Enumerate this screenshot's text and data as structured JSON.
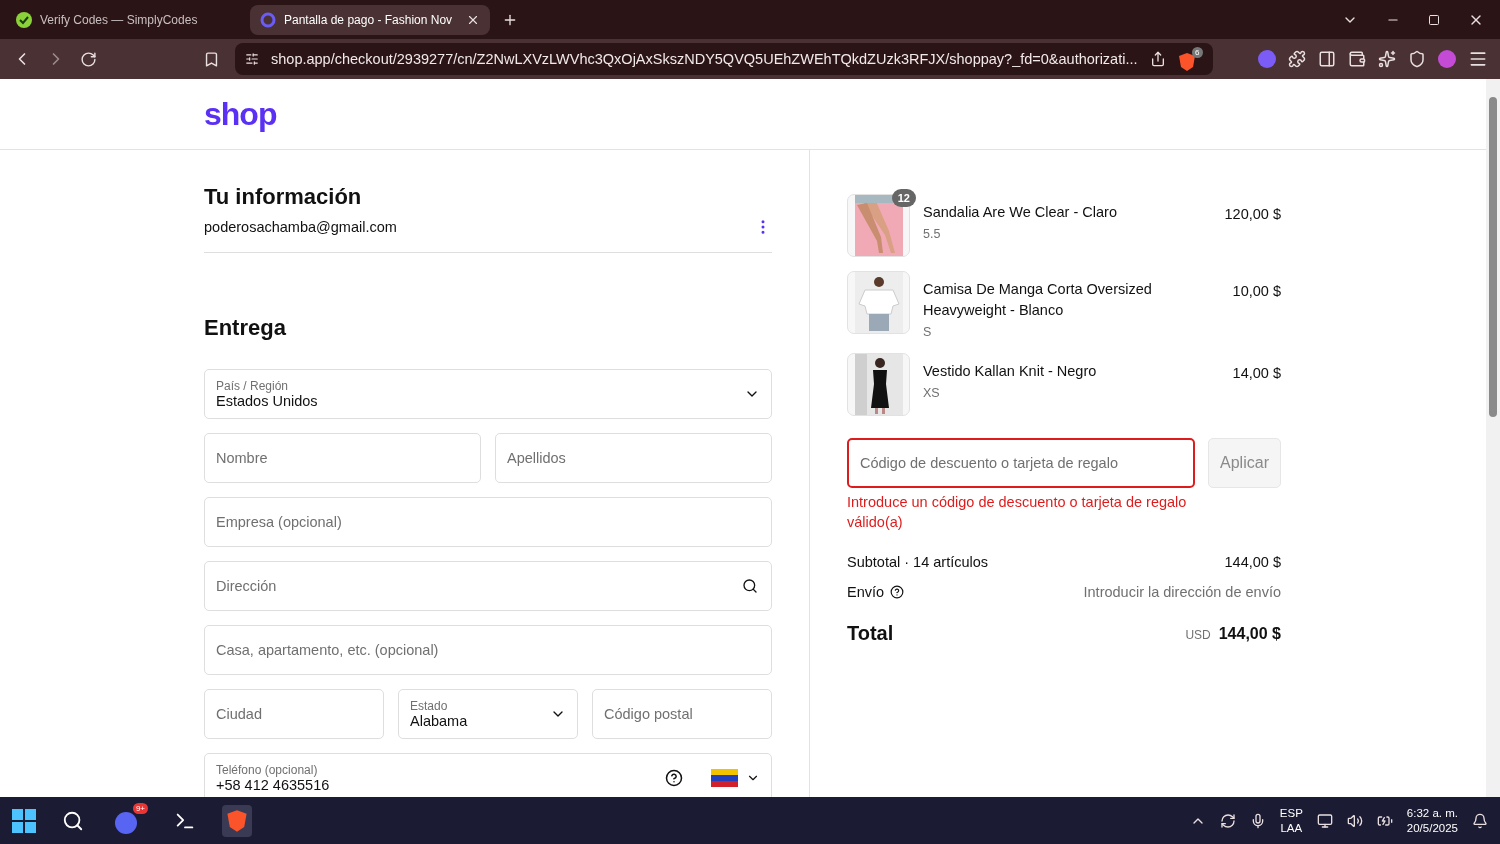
{
  "browser": {
    "tabs": [
      {
        "title": "Verify Codes — SimplyCodes",
        "selected": false,
        "kind": "simplycodes"
      },
      {
        "title": "Pantalla de pago - Fashion Nov",
        "selected": true,
        "kind": "shop"
      }
    ],
    "url": "shop.app/checkout/2939277/cn/Z2NwLXVzLWVhc3QxOjAxSkszNDY5QVQ5UEhZWEhTQkdZUzk3RFJX/shoppay?_fd=0&authorizati...",
    "shield_count": "6"
  },
  "header": {
    "logo": "shop"
  },
  "info": {
    "heading": "Tu información",
    "email": "poderosachamba@gmail.com"
  },
  "delivery": {
    "heading": "Entrega",
    "rows": [
      [
        {
          "kind": "select",
          "label": "País / Región",
          "value": "Estados Unidos"
        }
      ],
      [
        {
          "kind": "input",
          "placeholder": "Nombre"
        },
        {
          "kind": "input",
          "placeholder": "Apellidos"
        }
      ],
      [
        {
          "kind": "input",
          "placeholder": "Empresa (opcional)"
        }
      ],
      [
        {
          "kind": "search",
          "placeholder": "Dirección"
        }
      ],
      [
        {
          "kind": "input",
          "placeholder": "Casa, apartamento, etc. (opcional)"
        }
      ],
      [
        {
          "kind": "input",
          "placeholder": "Ciudad"
        },
        {
          "kind": "select",
          "label": "Estado",
          "value": "Alabama"
        },
        {
          "kind": "input",
          "placeholder": "Código postal"
        }
      ],
      [
        {
          "kind": "phone",
          "label": "Teléfono (opcional)",
          "value": "+58 412 4635516"
        }
      ]
    ]
  },
  "summary": {
    "items": [
      {
        "name": "Sandalia Are We Clear - Claro",
        "variant": "5.5",
        "price": "120,00 $",
        "quantity": "12",
        "kind": "legs"
      },
      {
        "name": "Camisa De Manga Corta Oversized Heavyweight - Blanco",
        "variant": "S",
        "price": "10,00 $",
        "kind": "shirt"
      },
      {
        "name": "Vestido Kallan Knit - Negro",
        "variant": "XS",
        "price": "14,00 $",
        "kind": "dress"
      }
    ],
    "discount": {
      "placeholder": "Código de descuento o tarjeta de regalo",
      "invalid": true,
      "button": "Aplicar",
      "error": "Introduce un código de descuento o tarjeta de regalo válido(a)"
    },
    "subtotal": {
      "label": "Subtotal · 14 artículos",
      "value": "144,00 $"
    },
    "shipping": {
      "label": "Envío",
      "value": "Introducir la dirección de envío"
    },
    "total": {
      "label": "Total",
      "currency": "USD",
      "value": "144,00 $"
    }
  },
  "taskbar": {
    "chat_badge": "9+",
    "lang": "ESP",
    "layout": "LAA",
    "time": "6:32 a. m.",
    "date": "20/5/2025"
  }
}
